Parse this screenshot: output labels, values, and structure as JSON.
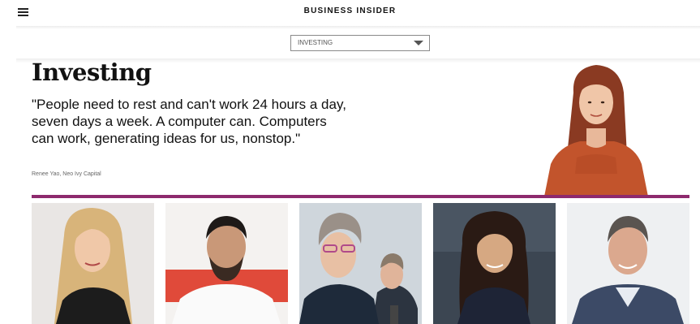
{
  "header": {
    "brand": "BUSINESS INSIDER",
    "menu_icon": "hamburger-menu-icon"
  },
  "section_select": {
    "value": "INVESTING",
    "icon": "dropdown-caret-icon"
  },
  "hero": {
    "title": "Investing",
    "quote": "\"People need to rest and can't work 24 hours a day, seven days a week. A computer can. Computers can work, generating ideas for us, nonstop.\"",
    "attribution": "Renee Yao, Neo Ivy Capital"
  },
  "colors": {
    "accent": "#8e2a6d"
  }
}
